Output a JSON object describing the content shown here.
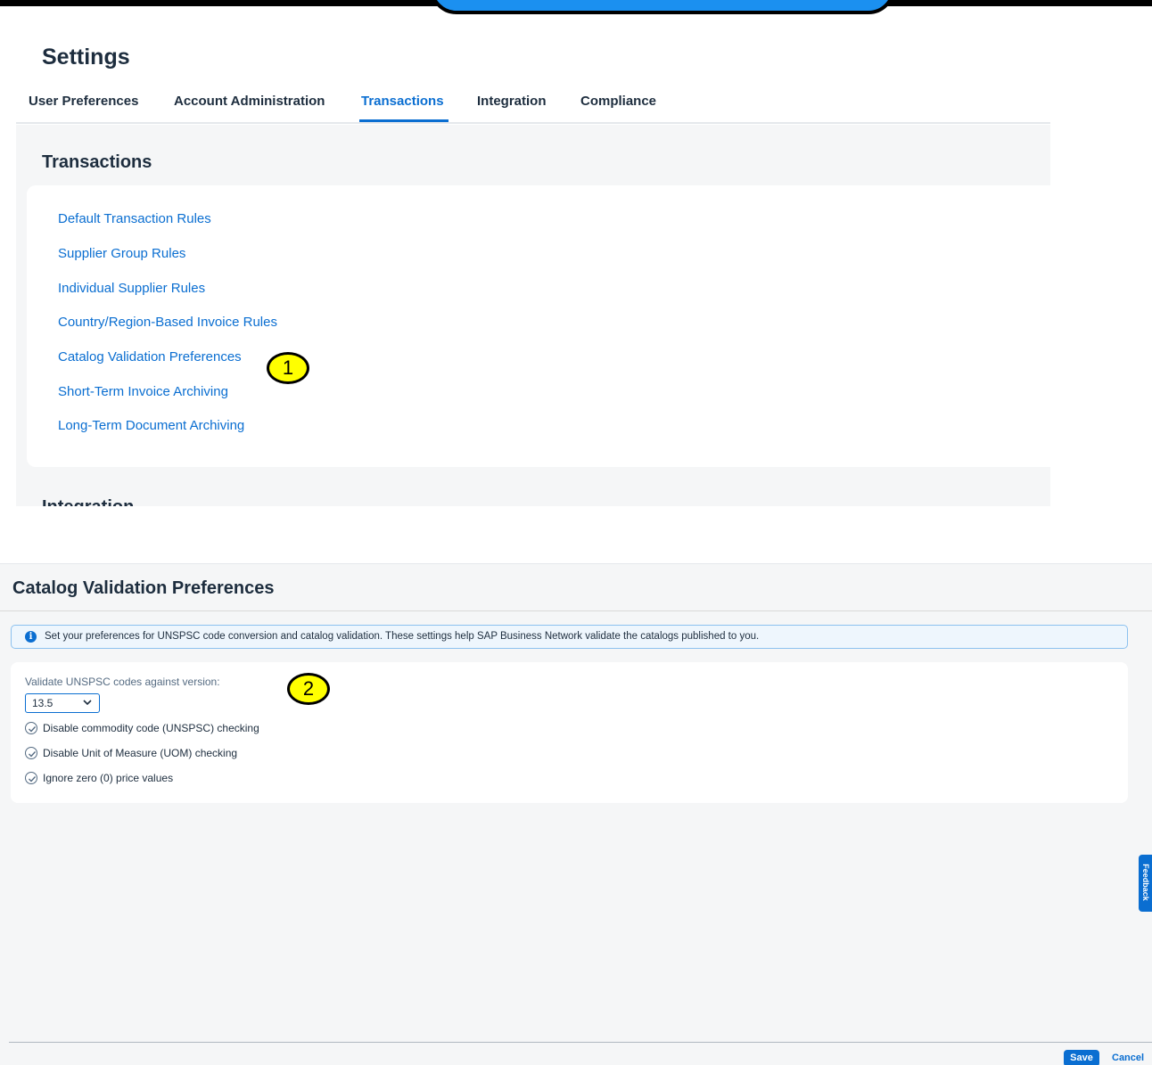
{
  "settings": {
    "title": "Settings",
    "tabs": [
      {
        "label": "User Preferences"
      },
      {
        "label": "Account Administration"
      },
      {
        "label": "Transactions"
      },
      {
        "label": "Integration"
      },
      {
        "label": "Compliance"
      }
    ],
    "active_tab": "Transactions"
  },
  "transactions": {
    "title": "Transactions",
    "links": [
      "Default Transaction Rules",
      "Supplier Group Rules",
      "Individual Supplier Rules",
      "Country/Region-Based Invoice Rules",
      "Catalog Validation Preferences",
      "Short-Term Invoice Archiving",
      "Long-Term Document Archiving"
    ],
    "next_section_title": "Integration"
  },
  "callouts": [
    "1",
    "2"
  ],
  "catalog_validation": {
    "title": "Catalog Validation Preferences",
    "info_icon": "info-icon",
    "info_text": "Set your preferences for UNSPSC code conversion and catalog validation. These settings help SAP Business Network validate the catalogs published to you.",
    "version_label": "Validate UNSPSC codes against version:",
    "version_value": "13.5",
    "checkboxes": [
      {
        "label": "Disable commodity code (UNSPSC) checking",
        "checked": true
      },
      {
        "label": "Disable Unit of Measure (UOM) checking",
        "checked": true
      },
      {
        "label": "Ignore zero (0) price values",
        "checked": true
      }
    ]
  },
  "feedback_label": "Feedback",
  "footer": {
    "save_label": "Save",
    "cancel_label": "Cancel"
  },
  "colors": {
    "accent": "#0a6ed1",
    "callout": "#ffff00",
    "top_pill": "#1b90f0"
  }
}
